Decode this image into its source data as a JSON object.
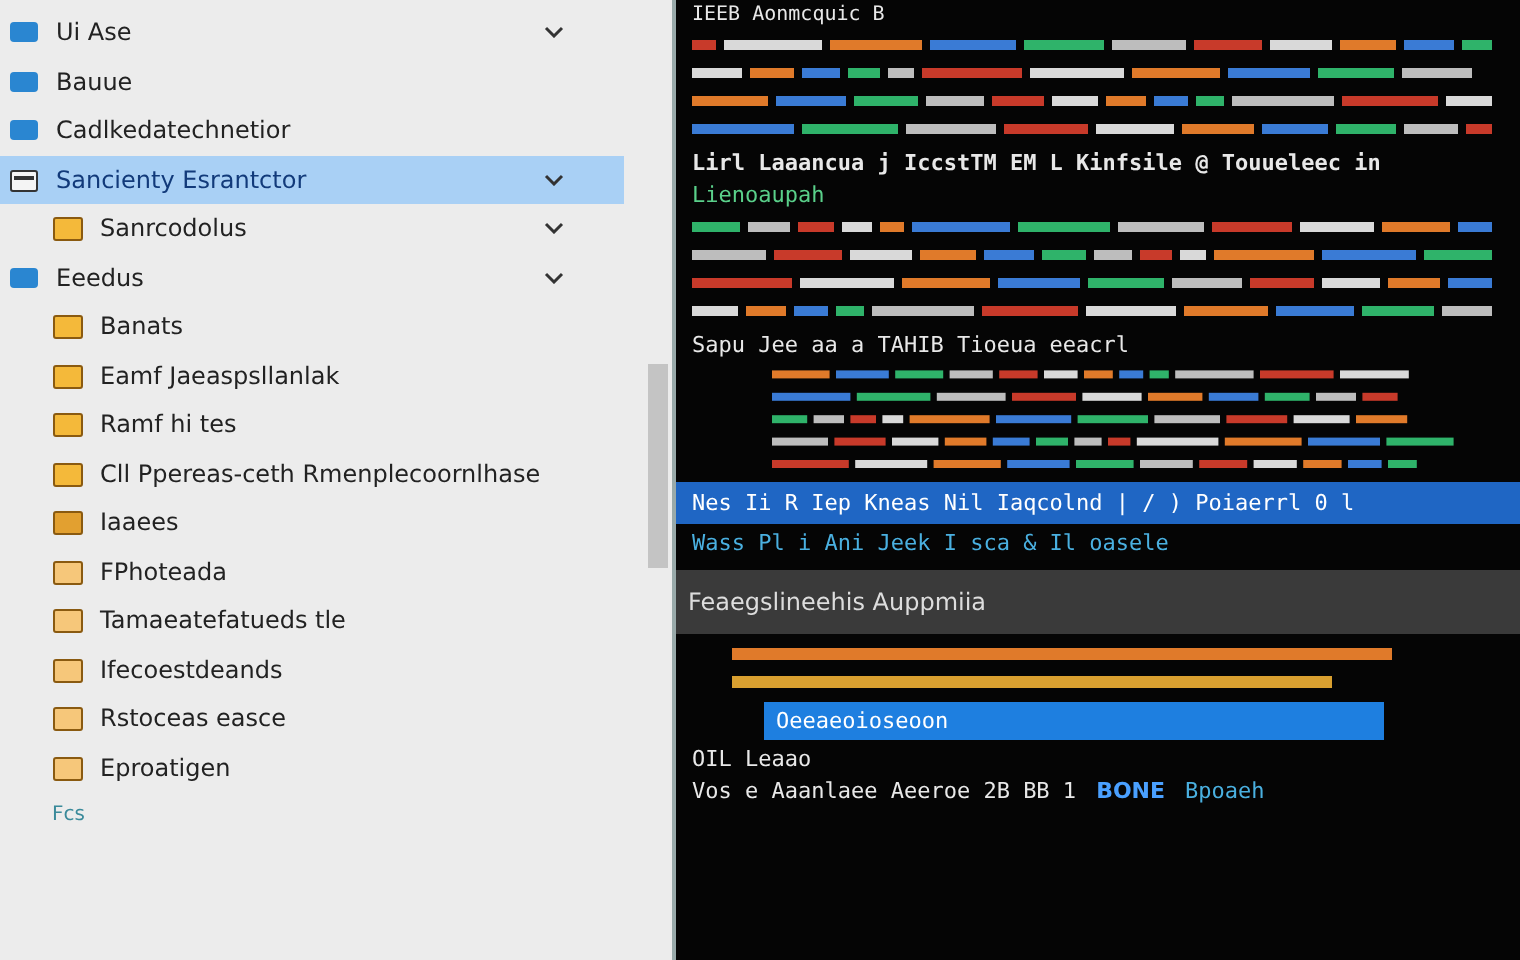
{
  "sidebar": {
    "items": [
      {
        "label": "Ui Ase",
        "kind": "drive",
        "selected": false,
        "chevron": true
      },
      {
        "label": "Bauue",
        "kind": "drive",
        "selected": false,
        "chevron": false
      },
      {
        "label": "Cadlkedatechnetior",
        "kind": "drive",
        "selected": false,
        "chevron": false
      },
      {
        "label": "Sancienty Esrantctor",
        "kind": "window",
        "selected": true,
        "chevron": true,
        "children": [
          {
            "label": "Sanrcodolus",
            "kind": "folder",
            "selected": false,
            "chevron": true
          }
        ]
      },
      {
        "label": "Eeedus",
        "kind": "drive",
        "selected": false,
        "chevron": true,
        "children": [
          {
            "label": "Banats",
            "kind": "folder",
            "selected": false,
            "chevron": false
          },
          {
            "label": "Eamf Jaeaspsllanlak",
            "kind": "folder",
            "selected": false,
            "chevron": false
          },
          {
            "label": "Ramf hi tes",
            "kind": "folder",
            "selected": false,
            "chevron": false
          },
          {
            "label": "Cll Ppereas-ceth Rmenplecoornlhase",
            "kind": "folder",
            "selected": false,
            "chevron": false
          },
          {
            "label": "Iaaees",
            "kind": "folder-red",
            "selected": false,
            "chevron": false
          },
          {
            "label": "FPhoteada",
            "kind": "folder-pale",
            "selected": false,
            "chevron": false
          },
          {
            "label": "Tamaeatefatueds tle",
            "kind": "folder-pale",
            "selected": false,
            "chevron": false
          },
          {
            "label": "Ifecoestdeands",
            "kind": "folder-pale",
            "selected": false,
            "chevron": false
          },
          {
            "label": "Rstoceas easce",
            "kind": "folder-pale",
            "selected": false,
            "chevron": false
          },
          {
            "label": "Eproatigen",
            "kind": "folder-pale",
            "selected": false,
            "chevron": false
          }
        ]
      }
    ],
    "footer": "Fcs"
  },
  "terminal": {
    "header": "IEEB Aonmcquic B",
    "heading": "Lirl Laaancua j IccstTM EM L Kinfsile @ Touueleec in",
    "subheading": "Lienoaupah",
    "line": "Sapu Jee aa a TAHIB Tioeua eeacrl",
    "bar": "Nes Ii R  Iep Kneas Nil Iaqcolnd | / ) Poiaerrl 0 l",
    "status": "Wass Pl i Ani Jeek I sca & Il oasele",
    "panel_title": "Feaegslineehis Auppmiia",
    "input": "Oeeaeoioseoon",
    "section": "OIL Leaao",
    "result": "Vos e Aaanlaee Aeeroe 2B BB 1",
    "badge": "BONE",
    "result_right": "Bpoaeh"
  }
}
